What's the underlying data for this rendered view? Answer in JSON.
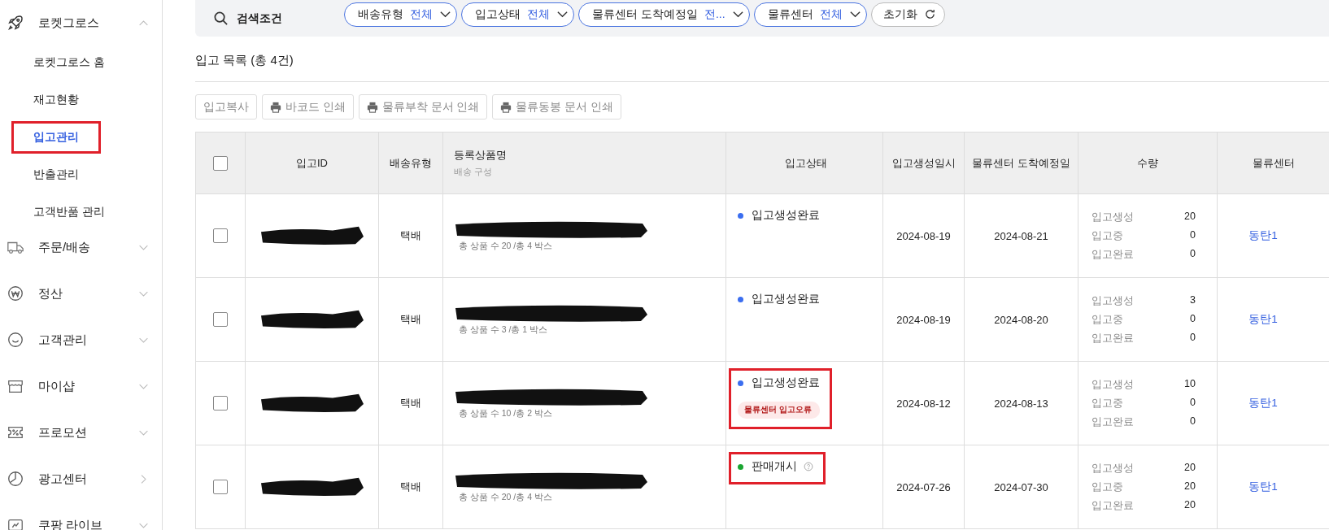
{
  "sidebar": {
    "items": [
      {
        "label": "로켓그로스",
        "expanded": true,
        "children": [
          {
            "label": "로켓그로스 홈",
            "selected": false,
            "highlighted": false
          },
          {
            "label": "재고현황",
            "selected": false,
            "highlighted": false
          },
          {
            "label": "입고관리",
            "selected": true,
            "highlighted": true
          },
          {
            "label": "반출관리",
            "selected": false,
            "highlighted": false
          },
          {
            "label": "고객반품 관리",
            "selected": false,
            "highlighted": false
          }
        ]
      },
      {
        "label": "주문/배송",
        "expanded": false
      },
      {
        "label": "정산",
        "expanded": false
      },
      {
        "label": "고객관리",
        "expanded": false
      },
      {
        "label": "마이샵",
        "expanded": false
      },
      {
        "label": "프로모션",
        "expanded": false
      },
      {
        "label": "광고센터",
        "expanded": false
      },
      {
        "label": "쿠팡 라이브",
        "expanded": false
      }
    ]
  },
  "filters": {
    "label": "검색조건",
    "chips": [
      {
        "label": "배송유형",
        "value": "전체"
      },
      {
        "label": "입고상태",
        "value": "전체"
      },
      {
        "label": "물류센터 도착예정일",
        "value": "전..."
      },
      {
        "label": "물류센터",
        "value": "전체"
      }
    ],
    "reset": "초기화"
  },
  "list": {
    "title": "입고 목록 (총 4건)",
    "buttons": [
      {
        "label": "입고복사",
        "icon": false
      },
      {
        "label": "바코드 인쇄",
        "icon": true
      },
      {
        "label": "물류부착 문서 인쇄",
        "icon": true
      },
      {
        "label": "물류동봉 문서 인쇄",
        "icon": true
      }
    ]
  },
  "table": {
    "select_all": false,
    "columns": [
      {
        "label": "입고ID"
      },
      {
        "label": "배송유형"
      },
      {
        "label": "등록상품명",
        "sub": "배송 구성"
      },
      {
        "label": "입고상태"
      },
      {
        "label": "입고생성일시"
      },
      {
        "label": "물류센터 도착예정일"
      },
      {
        "label": "수량"
      },
      {
        "label": "물류센터"
      }
    ],
    "rows": [
      {
        "checked": false,
        "id_redacted": true,
        "delivery": "택배",
        "name_redacted": true,
        "composition": "총 상품 수 20 /총 4 박스",
        "status": {
          "label": "입고생성완료",
          "color": "#3b6ef0",
          "highlighted": false
        },
        "created": "2024-08-19",
        "arrival": "2024-08-21",
        "quantity": [
          {
            "label": "입고생성",
            "value": "20"
          },
          {
            "label": "입고중",
            "value": "0"
          },
          {
            "label": "입고완료",
            "value": "0"
          }
        ],
        "center": "동탄1"
      },
      {
        "checked": false,
        "id_redacted": true,
        "delivery": "택배",
        "name_redacted": true,
        "composition": "총 상품 수 3 /총 1 박스",
        "status": {
          "label": "입고생성완료",
          "color": "#3b6ef0",
          "highlighted": false
        },
        "created": "2024-08-19",
        "arrival": "2024-08-20",
        "quantity": [
          {
            "label": "입고생성",
            "value": "3"
          },
          {
            "label": "입고중",
            "value": "0"
          },
          {
            "label": "입고완료",
            "value": "0"
          }
        ],
        "center": "동탄1"
      },
      {
        "checked": false,
        "id_redacted": true,
        "delivery": "택배",
        "name_redacted": true,
        "composition": "총 상품 수 10 /총 2 박스",
        "status": {
          "label": "입고생성완료",
          "color": "#3b6ef0",
          "highlighted": true,
          "badge": "물류센터 입고오류"
        },
        "created": "2024-08-12",
        "arrival": "2024-08-13",
        "quantity": [
          {
            "label": "입고생성",
            "value": "10"
          },
          {
            "label": "입고중",
            "value": "0"
          },
          {
            "label": "입고완료",
            "value": "0"
          }
        ],
        "center": "동탄1"
      },
      {
        "checked": false,
        "id_redacted": true,
        "delivery": "택배",
        "name_redacted": true,
        "composition": "총 상품 수 20 /총 4 박스",
        "status": {
          "label": "판매개시",
          "color": "#1aa531",
          "help": true,
          "highlighted": true
        },
        "created": "2024-07-26",
        "arrival": "2024-07-30",
        "quantity": [
          {
            "label": "입고생성",
            "value": "20"
          },
          {
            "label": "입고중",
            "value": "20"
          },
          {
            "label": "입고완료",
            "value": "20"
          }
        ],
        "center": "동탄1"
      }
    ]
  }
}
